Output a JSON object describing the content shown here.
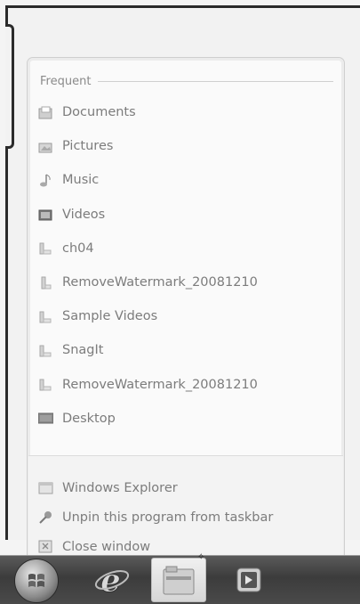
{
  "jumplist": {
    "section_header": "Frequent",
    "frequent_items": [
      {
        "label": "Documents",
        "icon": "documents-library-icon"
      },
      {
        "label": "Pictures",
        "icon": "pictures-library-icon"
      },
      {
        "label": "Music",
        "icon": "music-library-icon"
      },
      {
        "label": "Videos",
        "icon": "videos-library-icon"
      },
      {
        "label": "ch04",
        "icon": "folder-icon"
      },
      {
        "label": "RemoveWatermark_20081210",
        "icon": "folder-icon"
      },
      {
        "label": "Sample Videos",
        "icon": "folder-icon"
      },
      {
        "label": "SnagIt",
        "icon": "folder-icon"
      },
      {
        "label": "RemoveWatermark_20081210",
        "icon": "folder-icon"
      },
      {
        "label": "Desktop",
        "icon": "desktop-icon"
      }
    ],
    "tasks": [
      {
        "label": "Windows Explorer",
        "icon": "windows-explorer-icon"
      },
      {
        "label": "Unpin this program from taskbar",
        "icon": "unpin-icon"
      },
      {
        "label": "Close window",
        "icon": "close-window-icon"
      }
    ]
  },
  "taskbar": {
    "buttons": [
      {
        "name": "start-orb",
        "icon": "windows-logo-icon"
      },
      {
        "name": "internet-explorer",
        "icon": "internet-explorer-icon"
      },
      {
        "name": "windows-explorer",
        "icon": "folder-icon",
        "active": true
      },
      {
        "name": "media-player",
        "icon": "media-player-icon"
      }
    ]
  }
}
